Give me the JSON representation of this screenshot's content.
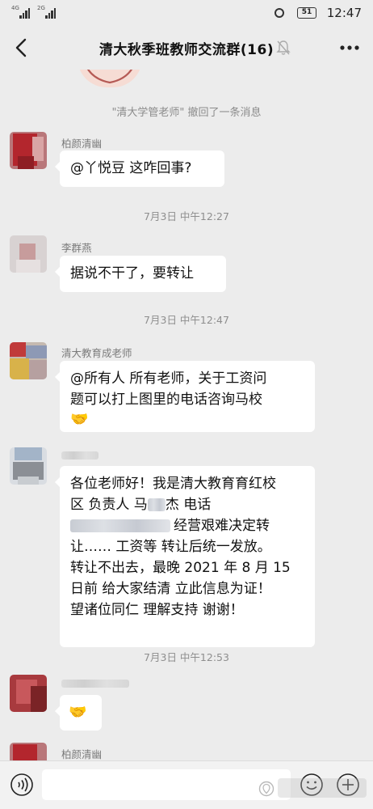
{
  "status_bar": {
    "signal_1_tag": "4G",
    "signal_2_tag": "2G",
    "battery": "51",
    "time": "12:47"
  },
  "header": {
    "title": "清大秋季班教师交流群(16)"
  },
  "chat": {
    "system_notice": "\"清大学管老师\" 撤回了一条消息",
    "messages": [
      {
        "sender": "柏颜清幽",
        "text": "@丫悦豆  这咋回事?"
      },
      {
        "time": "7月3日 中午12:27"
      },
      {
        "sender": "李群燕",
        "text": "据说不干了，要转让"
      },
      {
        "time": "7月3日 中午12:47"
      },
      {
        "sender": "清大教育成老师",
        "lines": [
          "@所有人  所有老师，关于工资问",
          "题可以打上图里的电话咨询马校"
        ],
        "emoji": "🤝"
      },
      {
        "lines": [
          "各位老师好！我是清大教育育红校",
          "区 负责人 马",
          "杰 电话",
          "经营艰难决定转",
          "让…… 工资等 转让后统一发放。",
          "转让不出去，最晚 2021 年 8 月 15",
          "日前 给大家结清 立此信息为证！",
          "望诸位同仁 理解支持  谢谢！"
        ]
      },
      {
        "time": "7月3日 中午12:53"
      },
      {
        "emoji": "🤝"
      },
      {
        "sender": "柏颜清幽"
      }
    ]
  },
  "icons": {
    "back": "back-arrow-icon",
    "mute": "bell-muted-icon",
    "more": "more-dots-icon",
    "voice": "voice-icon",
    "emoji": "emoji-icon",
    "plus": "plus-icon"
  },
  "colors": {
    "background": "#ececec",
    "bubble": "#ffffff",
    "meta_text": "#8e8e8e"
  }
}
